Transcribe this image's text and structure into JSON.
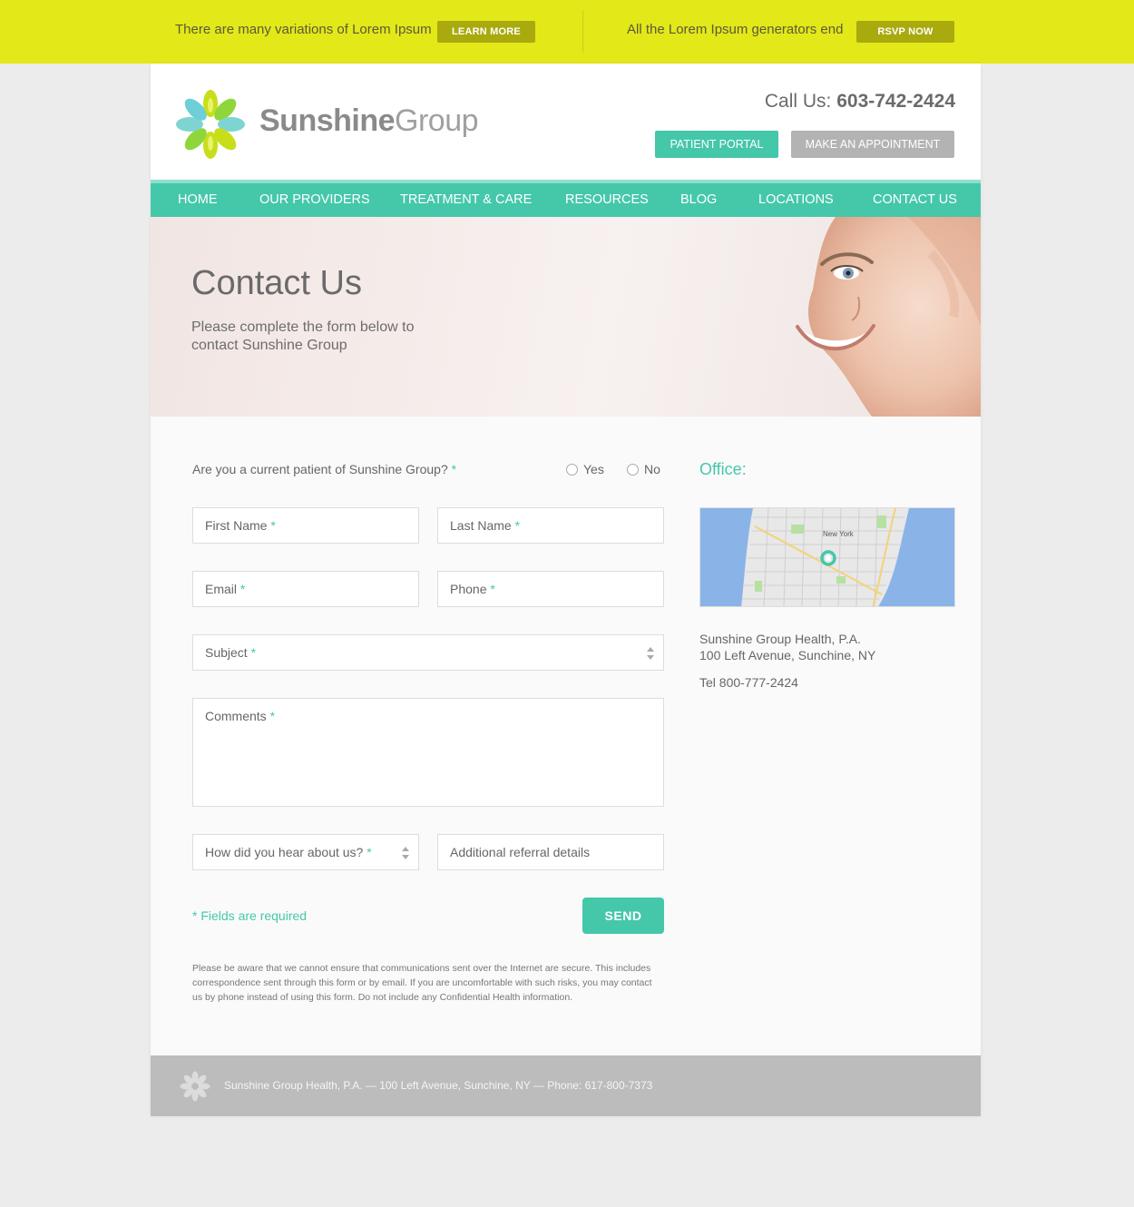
{
  "promo": {
    "left_text": "There are many variations of Lorem Ipsum",
    "left_button": "LEARN MORE",
    "right_text": "All the Lorem Ipsum generators end",
    "right_button": "RSVP NOW"
  },
  "header": {
    "logo_bold": "Sunshine",
    "logo_light": "Group",
    "call_label": "Call Us:",
    "call_number": "603-742-2424",
    "patient_portal": "PATIENT PORTAL",
    "appointment": "MAKE AN APPOINTMENT"
  },
  "nav": {
    "items": [
      {
        "label": "HOME"
      },
      {
        "label": "OUR PROVIDERS"
      },
      {
        "label": "TREATMENT & CARE"
      },
      {
        "label": "RESOURCES"
      },
      {
        "label": "BLOG"
      },
      {
        "label": "LOCATIONS"
      },
      {
        "label": "CONTACT US"
      }
    ]
  },
  "hero": {
    "title": "Contact Us",
    "subtitle": "Please complete the form below to contact Sunshine Group"
  },
  "form": {
    "patient_question": "Are you a current patient of Sunshine Group?",
    "required_mark": "*",
    "radio_yes": "Yes",
    "radio_no": "No",
    "first_name": "First Name",
    "last_name": "Last Name",
    "email": "Email",
    "phone": "Phone",
    "subject": "Subject",
    "comments": "Comments",
    "hear_about": "How did you hear about us?",
    "referral": "Additional referral details",
    "required_note": "* Fields are required",
    "send": "SEND",
    "disclaimer": "Please be aware that we cannot ensure that communications sent over the Internet are secure. This includes correspondence sent through this form or by email. If you are uncomfortable with such risks, you may contact us by phone instead of using this form. Do not include any Confidential Health information."
  },
  "office": {
    "title": "Office:",
    "map_label_1": "New York",
    "address_line1": "Sunshine Group Health, P.A.",
    "address_line2": "100 Left Avenue, Sunchine, NY",
    "tel": "Tel 800-777-2424"
  },
  "footer": {
    "text": "Sunshine Group Health, P.A.  — 100 Left Avenue, Sunchine, NY — Phone: 617-800-7373"
  },
  "colors": {
    "accent": "#45c7aa",
    "promo_bg": "#e3e818",
    "promo_button": "#a8aa0e",
    "appointment_button": "#b3b3b3",
    "footer_bg": "#bcbcbc"
  }
}
